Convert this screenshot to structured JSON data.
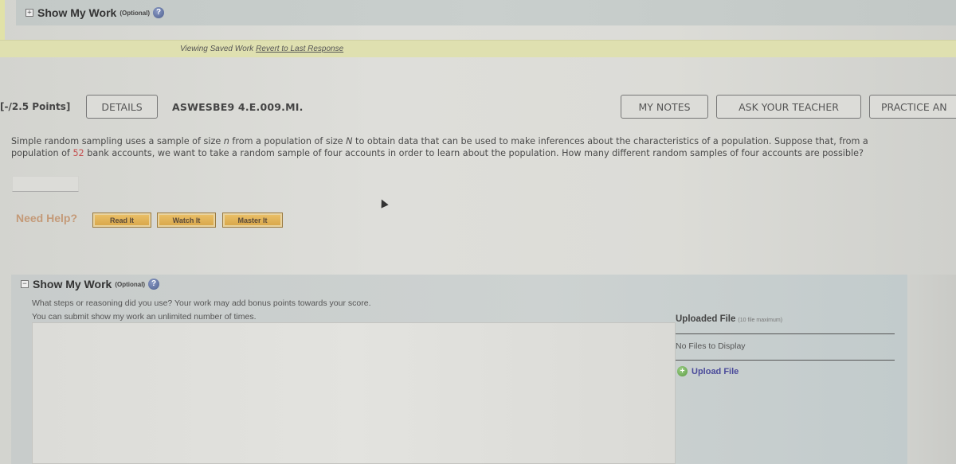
{
  "top_show_my_work": {
    "toggle": "+",
    "title": "Show My Work",
    "optional": "(Optional)",
    "help": "?"
  },
  "saved_bar": {
    "text": "Viewing Saved Work",
    "revert_link": "Revert to Last Response"
  },
  "question_header": {
    "points": "[-/2.5 Points]",
    "details_button": "DETAILS",
    "question_id": "ASWESBE9 4.E.009.MI.",
    "my_notes_button": "MY NOTES",
    "ask_teacher_button": "ASK YOUR TEACHER",
    "practice_button": "PRACTICE AN"
  },
  "question": {
    "part1": "Simple random sampling uses a sample of size ",
    "n": "n",
    "part2": " from a population of size ",
    "N": "N",
    "part3": " to obtain data that can be used to make inferences about the characteristics of a population. Suppose that, from a population of ",
    "population_value": "52",
    "part4": " bank accounts, we want to take a random sample of four accounts in order to learn about the population. How many different random samples of four accounts are possible?",
    "answer_value": ""
  },
  "need_help": {
    "label": "Need Help?",
    "buttons": [
      "Read It",
      "Watch It",
      "Master It"
    ]
  },
  "show_my_work": {
    "toggle": "−",
    "title": "Show My Work",
    "optional": "(Optional)",
    "help": "?",
    "line1": "What steps or reasoning did you use? Your work may add bonus points towards your score.",
    "line2": "You can submit show my work an unlimited number of times.",
    "work_value": ""
  },
  "upload": {
    "title": "Uploaded File",
    "limit": "(10 file maximum)",
    "empty": "No Files to Display",
    "upload_link": "Upload File",
    "plus": "+"
  }
}
